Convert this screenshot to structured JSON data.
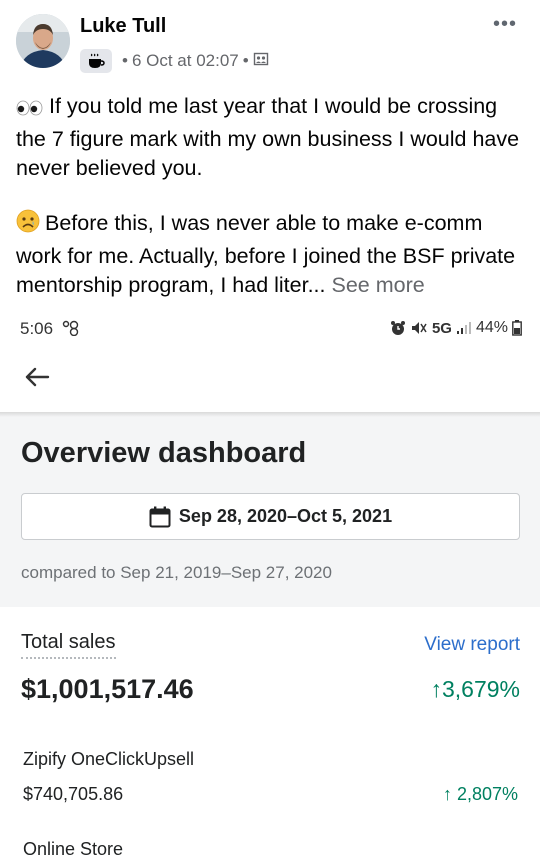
{
  "post": {
    "author": "Luke Tull",
    "timestamp": "6 Oct at 02:07",
    "paragraph1": "If you told me last year that I would be crossing the 7 figure mark with my own business I would have never believed you.",
    "paragraph2": "Before this, I was never able to make e-comm work for me. Actually, before I joined the BSF private mentorship program, I had liter...",
    "see_more": "See more",
    "more_glyph": "•••"
  },
  "status_bar": {
    "time": "5:06",
    "network": "5G",
    "battery": "44%"
  },
  "dashboard": {
    "title": "Overview dashboard",
    "date_range": "Sep 28, 2020–Oct 5, 2021",
    "compared": "compared to Sep 21, 2019–Sep 27, 2020",
    "total_sales": {
      "label": "Total sales",
      "view_report": "View report",
      "value": "$1,001,517.46",
      "change": "↑3,679%"
    },
    "breakdown": [
      {
        "label": "Zipify OneClickUpsell",
        "value": "$740,705.86",
        "change": "↑ 2,807%"
      },
      {
        "label": "Online Store"
      }
    ]
  },
  "colors": {
    "positive": "#008060",
    "link": "#2c6ecb"
  }
}
